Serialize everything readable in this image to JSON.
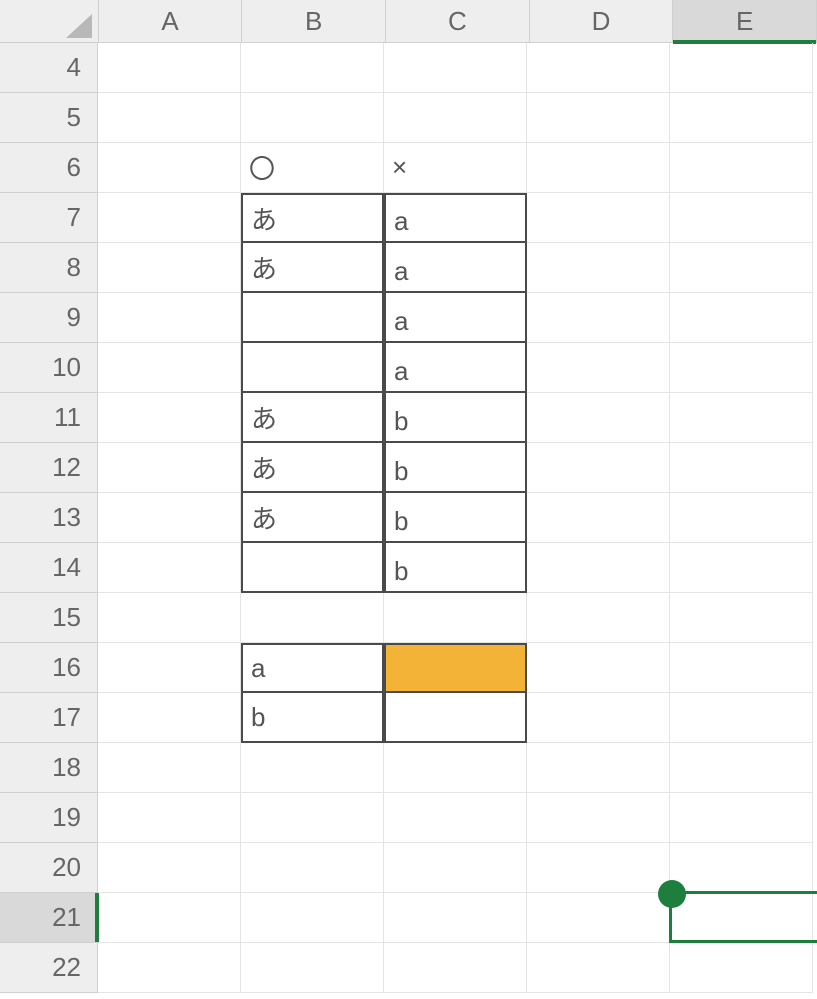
{
  "columns": [
    "A",
    "B",
    "C",
    "D",
    "E"
  ],
  "columnCount": 5,
  "activeColumnIndex": 4,
  "rowStart": 4,
  "rowEnd": 22,
  "activeRowNumber": 21,
  "cells": {
    "B6": "〇",
    "C6": "×",
    "B7": "あ",
    "C7": "a",
    "B8": "あ",
    "C8": "a",
    "C9": "a",
    "C10": "a",
    "B11": "あ",
    "C11": "b",
    "B12": "あ",
    "C12": "b",
    "B13": "あ",
    "C13": "b",
    "C14": "b",
    "B16": "a",
    "B17": "b"
  },
  "borderedRegions": [
    {
      "startRow": 7,
      "endRow": 14,
      "startCol": "B",
      "endCol": "C"
    },
    {
      "startRow": 16,
      "endRow": 17,
      "startCol": "B",
      "endCol": "C"
    }
  ],
  "filledCells": {
    "C16": "orange"
  },
  "bottomAlignColumns": [
    "C"
  ],
  "bottomAlignRows": [
    7,
    8,
    9,
    10,
    11,
    12,
    13,
    14
  ],
  "selection": {
    "col": "E",
    "row": 21
  },
  "colors": {
    "accent": "#1e7e3e",
    "fillOrange": "#f3b336"
  }
}
